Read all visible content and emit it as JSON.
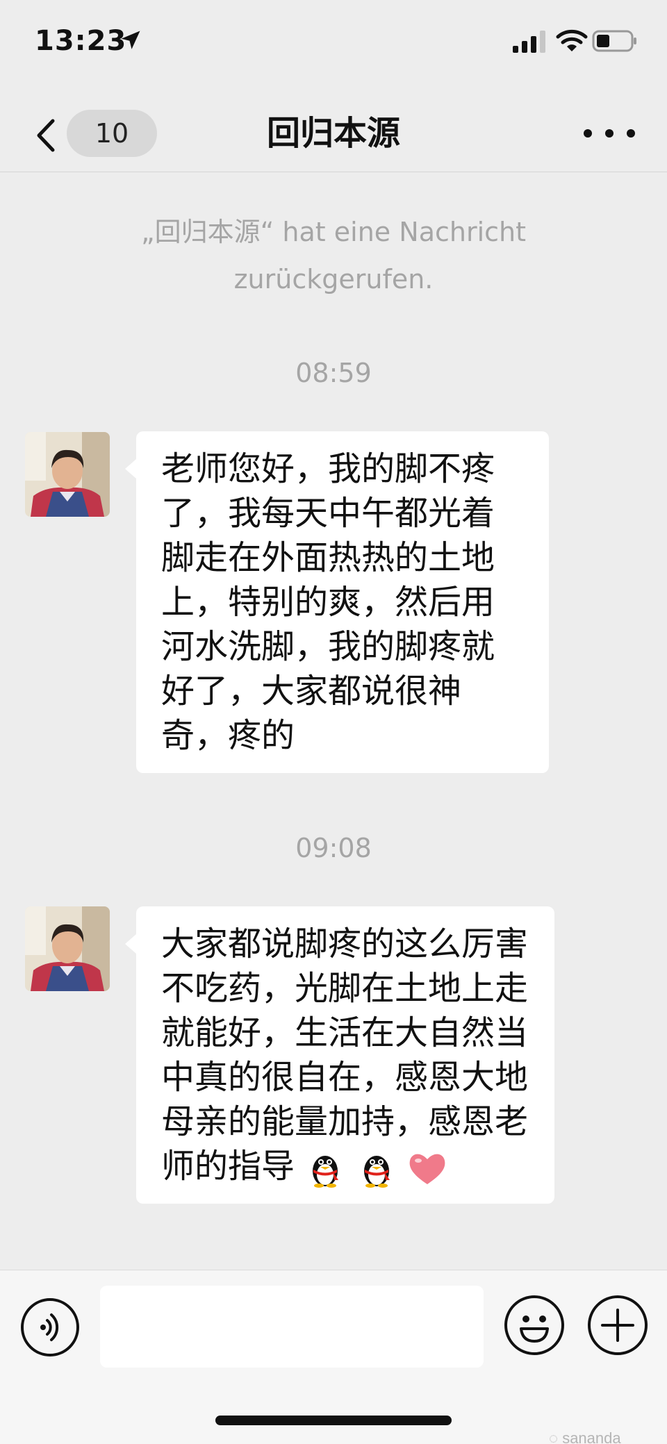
{
  "status_bar": {
    "time": "13:23"
  },
  "nav": {
    "back_badge": "10",
    "title": "回归本源"
  },
  "system_notice": "„回归本源“ hat eine Nachricht zurückgerufen.",
  "messages": [
    {
      "time": "08:59",
      "text": "老师您好，我的脚不疼了，我每天中午都光着脚走在外面热热的土地上，特别的爽，然后用河水洗脚，我的脚疼就好了，大家都说很神奇，疼的"
    },
    {
      "time": "09:08",
      "text": "大家都说脚疼的这么厉害不吃药，光脚在土地上走就能好，生活在大自然当中真的很自在，感恩大地母亲的能量加持，感恩老师的指导",
      "emojis": [
        "penguin-emoji",
        "penguin-emoji",
        "heart-emoji"
      ]
    }
  ],
  "input": {
    "placeholder": ""
  },
  "watermark": "sananda"
}
